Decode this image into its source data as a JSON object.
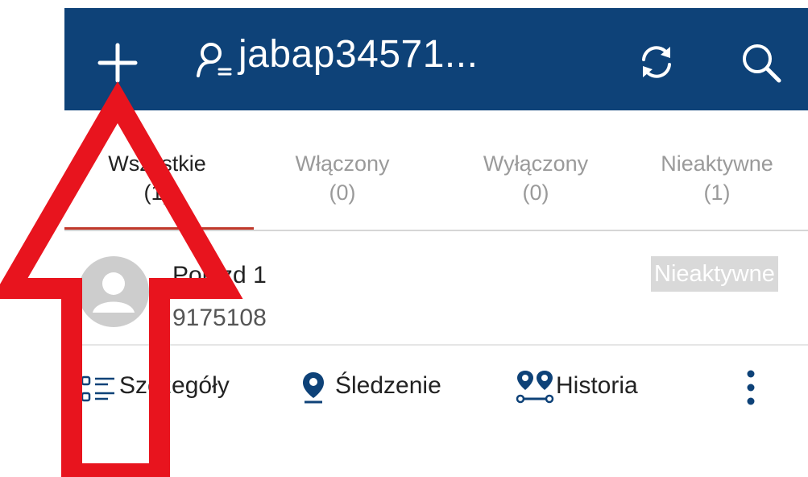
{
  "header": {
    "title": "jabap34571...",
    "icons": [
      "plus-icon",
      "user-list-icon",
      "refresh-icon",
      "search-icon"
    ],
    "background": "#0e4278"
  },
  "tabs": [
    {
      "label": "Wszystkie",
      "count": "(1)",
      "active": true
    },
    {
      "label": "Włączony",
      "count": "(0)",
      "active": false
    },
    {
      "label": "Wyłączony",
      "count": "(0)",
      "active": false
    },
    {
      "label": "Nieaktywne",
      "count": "(1)",
      "active": false
    }
  ],
  "vehicle": {
    "name": "Pojazd 1",
    "number": "9175108",
    "status": "Nieaktywne"
  },
  "actions": {
    "details": "Szczegóły",
    "tracking": "Śledzenie",
    "history": "Historia"
  },
  "colors": {
    "accent": "#c0392b",
    "annotation_arrow": "#e8141e",
    "icon_blue": "#0e4278"
  }
}
